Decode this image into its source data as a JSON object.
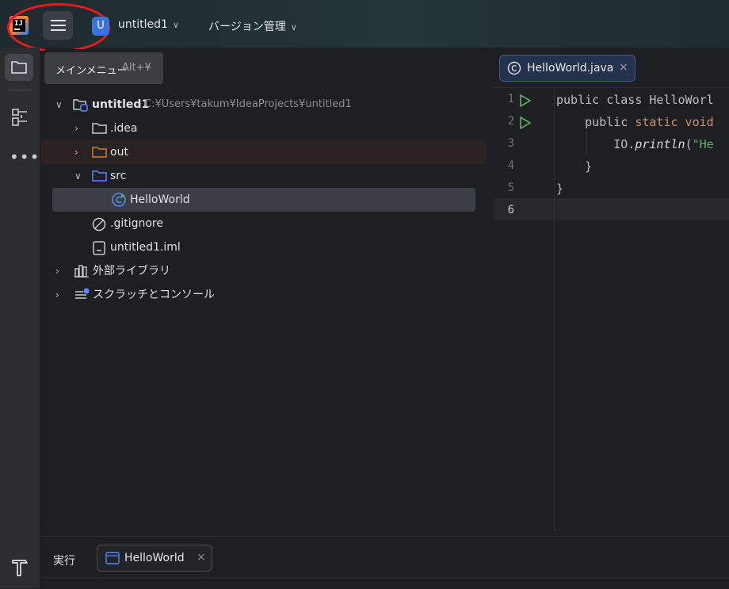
{
  "titlebar": {
    "logo_text": "IJ",
    "project_badge": "U",
    "project_name": "untitled1",
    "vcs_menu": "バージョン管理"
  },
  "tooltip": {
    "label": "メインメニュー",
    "shortcut": "Alt+¥"
  },
  "project_tree": {
    "root_name": "untitled1",
    "root_path": "C:¥Users¥takum¥IdeaProjects¥untitled1",
    "idea": ".idea",
    "out": "out",
    "src": "src",
    "helloworld": "HelloWorld",
    "gitignore": ".gitignore",
    "iml": "untitled1.iml",
    "external_libraries": "外部ライブラリ",
    "scratches": "スクラッチとコンソール"
  },
  "editor": {
    "tab_label": "HelloWorld.java",
    "line_numbers": [
      "1",
      "2",
      "3",
      "4",
      "5",
      "6"
    ],
    "code": {
      "l1": "public class HelloWorl",
      "l2_kw1": "public ",
      "l2_kw2": "static void",
      "l3_obj": "IO.",
      "l3_fn": "println",
      "l3_paren": "(",
      "l3_str": "\"He",
      "l4": "}",
      "l5": "}"
    }
  },
  "bottom": {
    "run_label": "実行",
    "run_tab": "HelloWorld"
  },
  "colors": {
    "accent_blue": "#3d72d6",
    "highlight_red": "#e81b1b",
    "run_green": "#59a869",
    "folder_orange": "#c77d3a",
    "folder_blue": "#548af7"
  },
  "icons": [
    "menu-icon",
    "folder-icon",
    "structure-icon",
    "more-icon",
    "build-icon",
    "chevron-down-icon",
    "chevron-right-icon",
    "module-icon",
    "class-icon",
    "gitignore-icon",
    "iml-file-icon",
    "library-icon",
    "scratch-icon",
    "run-icon",
    "close-icon",
    "console-icon"
  ]
}
